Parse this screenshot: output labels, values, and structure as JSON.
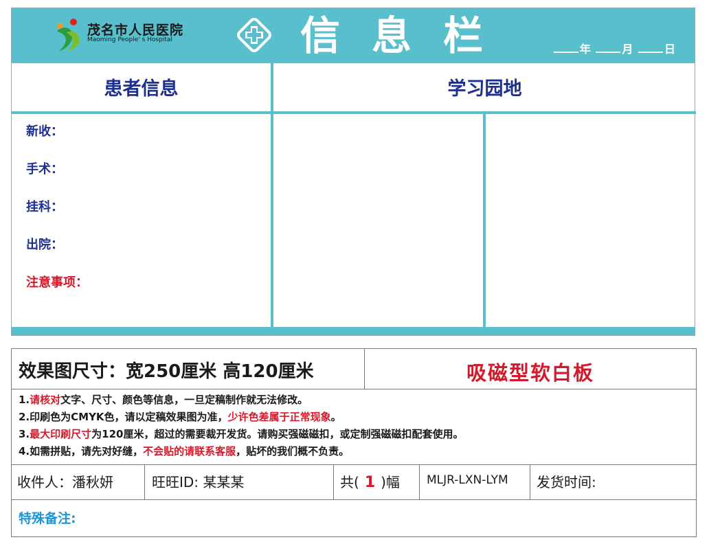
{
  "header": {
    "hospital_name_cn": "茂名市人民医院",
    "hospital_name_en": "Maoming People' s Hospital",
    "title": "信息栏",
    "date_year_label": "年",
    "date_month_label": "月",
    "date_day_label": "日"
  },
  "left_panel": {
    "heading": "患者信息",
    "fields": [
      {
        "label": "新收："
      },
      {
        "label": "手术："
      },
      {
        "label": "挂科："
      },
      {
        "label": "出院："
      }
    ],
    "notice_label": "注意事项："
  },
  "right_panel": {
    "heading": "学习园地"
  },
  "spec": {
    "size_text": "效果图尺寸：宽250厘米  高120厘米",
    "board_type": "吸磁型软白板",
    "notes": [
      {
        "num": "1.",
        "hl": "请核对",
        "rest": "文字、尺寸、颜色等信息，一旦定稿制作就无法修改。"
      },
      {
        "pre": "2.印刷色为CMYK色，请以定稿效果图为准，",
        "hl": "少许色差属于正常现象",
        "rest": "。"
      },
      {
        "num": "3.",
        "hl": "最大印刷尺寸",
        "rest": "为120厘米，超过的需要裁开发货。请购买强磁磁扣，或定制强磁磁扣配套使用。"
      },
      {
        "pre": "4.如需拼贴，请先对好缝，",
        "hl": "不会贴的请联系客服",
        "rest": "，贴坏的我们概不负责。"
      }
    ],
    "recipient": "收件人：潘秋妍",
    "wangwang": "旺旺ID:   某某某",
    "qty_prefix": "共(",
    "qty_value": "1",
    "qty_suffix": ")幅",
    "code": "MLJR-LXN-LYM",
    "ship_time": "发货时间:",
    "remark": "特殊备注:"
  },
  "colors": {
    "teal": "#59bfcd",
    "navy": "#1d2f8f",
    "red": "#d6192a",
    "blue": "#1e96d6"
  },
  "icons": {
    "logo": "hospital-logo-icon",
    "badge": "medical-cross-icon"
  }
}
